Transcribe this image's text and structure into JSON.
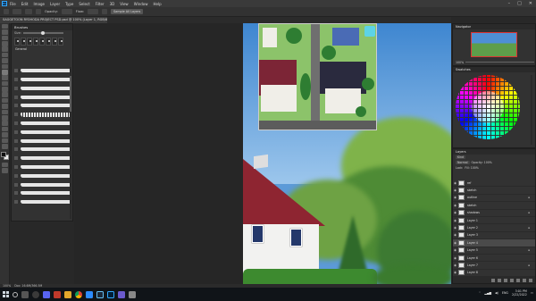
{
  "menubar": {
    "logo": "Ps",
    "items": [
      "File",
      "Edit",
      "Image",
      "Layer",
      "Type",
      "Select",
      "Filter",
      "3D",
      "View",
      "Window",
      "Help"
    ],
    "controls": [
      "–",
      "□",
      "✕"
    ]
  },
  "options": {
    "label_opacity": "Opacity:",
    "label_flow": "Flow:",
    "sample_btn": "Sample All Layers"
  },
  "document": {
    "tab_title": "SAGGETOON RYOHODA PROJECT PSD.psd @ 100% (Layer 1, RGB/8)"
  },
  "brushes": {
    "title": "Brushes",
    "size_label": "Size:",
    "folder": "General"
  },
  "navigator": {
    "title": "Navigator",
    "zoom": "100%"
  },
  "swatches": {
    "title": "Swatches"
  },
  "layers": {
    "title": "Layers",
    "kind": "Kind",
    "blend": "Normal",
    "opacity": "Opacity: 100%",
    "lock": "Lock:",
    "fill": "Fill: 100%",
    "rows": [
      "ref",
      "sketch",
      "outline",
      "sketch",
      "shadows",
      "Layer 1",
      "Layer 2",
      "Layer 3",
      "Layer 4",
      "Layer 5",
      "Layer 6",
      "Layer 7",
      "Layer 8"
    ]
  },
  "status": {
    "zoom": "100%",
    "doc": "Doc: 16.6M/366.5M"
  },
  "taskbar": {
    "time": "3:01 PM",
    "date": "2/22/2022",
    "lang": "ENG"
  }
}
